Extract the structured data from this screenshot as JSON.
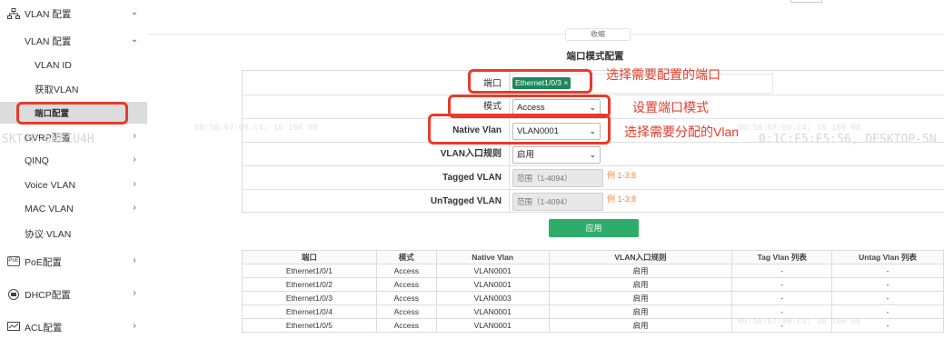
{
  "sidebar": {
    "vlan_config_label": "VLAN 配置",
    "vlan_config_sub_label": "VLAN 配置",
    "vlan_id_label": "VLAN ID",
    "get_vlan_label": "获取VLAN",
    "port_config_label": "端口配置",
    "gvrp_label": "GVRP配置",
    "qinq_label": "QINQ",
    "voice_vlan_label": "Voice VLAN",
    "mac_vlan_label": "MAC VLAN",
    "protocol_vlan_label": "协议 VLAN",
    "poe_label": "PoE配置",
    "dhcp_label": "DHCP配置",
    "acl_label": "ACL配置"
  },
  "main": {
    "collapse_label": "收缩",
    "title": "端口模式配置",
    "form": {
      "port_label": "端口",
      "port_tag": "Ethernet1/0/3 ×",
      "mode_label": "模式",
      "mode_value": "Access",
      "native_vlan_label": "Native Vlan",
      "native_vlan_value": "VLAN0001",
      "ingress_rule_label": "VLAN入口规则",
      "ingress_rule_value": "启用",
      "tagged_label": "Tagged VLAN",
      "tagged_placeholder": "范围（1-4094）",
      "tagged_hint": "例 1-3;8",
      "untagged_label": "UnTagged VLAN",
      "untagged_placeholder": "范围（1-4094）",
      "untagged_hint": "例 1-3;8"
    },
    "apply_label": "应用",
    "annotations": {
      "port": "选择需要配置的端口",
      "mode": "设置端口模式",
      "native": "选择需要分配的Vlan"
    },
    "table": {
      "headers": [
        "端口",
        "模式",
        "Native Vlan",
        "VLAN入口规则",
        "Tag Vlan 列表",
        "Untag Vlan 列表"
      ],
      "rows": [
        [
          "Ethernet1/0/1",
          "Access",
          "VLAN0001",
          "启用",
          "-",
          "-"
        ],
        [
          "Ethernet1/0/2",
          "Access",
          "VLAN0001",
          "启用",
          "-",
          "-"
        ],
        [
          "Ethernet1/0/3",
          "Access",
          "VLAN0003",
          "启用",
          "-",
          "-"
        ],
        [
          "Ethernet1/0/4",
          "Access",
          "VLAN0001",
          "启用",
          "-",
          "-"
        ],
        [
          "Ethernet1/0/5",
          "Access",
          "VLAN0001",
          "启用",
          "-",
          "-"
        ]
      ]
    }
  },
  "watermarks": {
    "w1": "SKTOP-5NKIU4H",
    "w2": "00:58:67:00:c4; 16 160 08",
    "w3": "00:58:67:00:c4; 16 160 08",
    "w4": "0:1C:F5:F5:56, DESKTOP-5N",
    "w5": "00:58:67:00:c4; 16 160 08"
  },
  "colors": {
    "accent": "#2ead6a",
    "annotation": "#e83b2a",
    "hint": "#e88a3b",
    "tag": "#1a8a5a"
  }
}
